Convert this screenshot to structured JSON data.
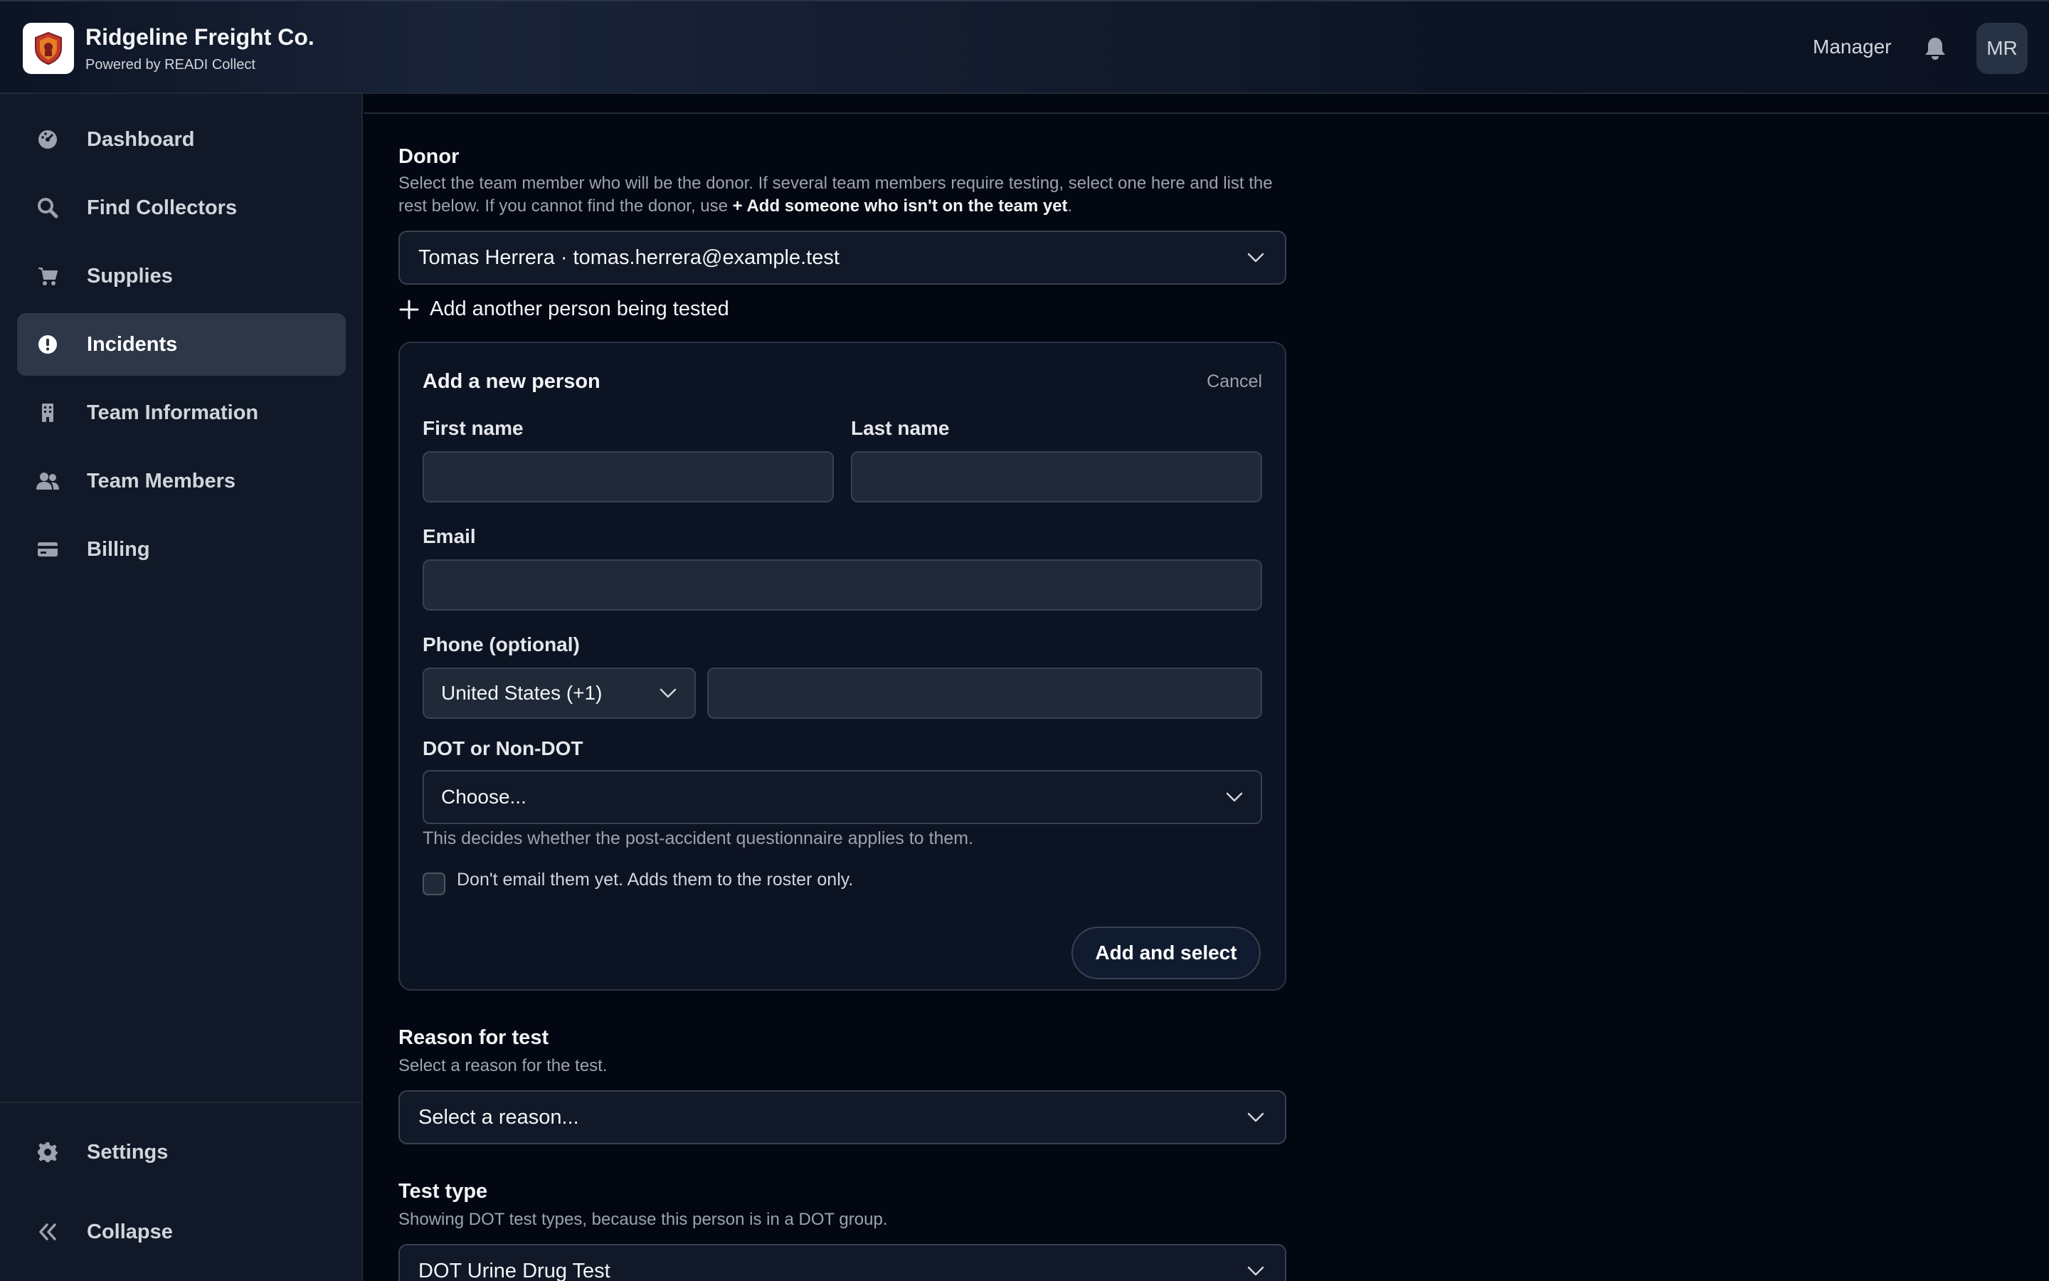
{
  "header": {
    "title": "Ridgeline Freight Co.",
    "subtitle": "Powered by READI Collect",
    "role": "Manager",
    "avatar_initials": "MR",
    "logo_icon": "shield-logo",
    "bell_icon": "bell-icon"
  },
  "sidebar": {
    "items": [
      {
        "label": "Dashboard",
        "icon": "gauge-icon",
        "active": false
      },
      {
        "label": "Find Collectors",
        "icon": "search-icon",
        "active": false
      },
      {
        "label": "Supplies",
        "icon": "cart-icon",
        "active": false
      },
      {
        "label": "Incidents",
        "icon": "alert-icon",
        "active": true
      },
      {
        "label": "Team Information",
        "icon": "building-icon",
        "active": false
      },
      {
        "label": "Team Members",
        "icon": "users-icon",
        "active": false
      },
      {
        "label": "Billing",
        "icon": "card-icon",
        "active": false
      }
    ],
    "footer": [
      {
        "label": "Settings",
        "icon": "gear-icon"
      },
      {
        "label": "Collapse",
        "icon": "double-chevron-left-icon"
      }
    ]
  },
  "donor": {
    "title": "Donor",
    "help_part1": "Select the team member who will be the donor. If several team members require testing, select one here and list the rest below. If you cannot find the donor, use",
    "help_link": "+ Add someone who isn't on the team yet",
    "help_end": ".",
    "selected": "Tomas Herrera · tomas.herrera@example.test",
    "add_another": "Add another person being tested"
  },
  "new_person": {
    "title": "Add a new person",
    "cancel": "Cancel",
    "first_name_label": "First name",
    "first_name_value": "",
    "last_name_label": "Last name",
    "last_name_value": "",
    "email_label": "Email",
    "email_value": "",
    "phone_label": "Phone (optional)",
    "phone_country": "United States (+1)",
    "phone_value": "",
    "dot_label": "DOT or Non-DOT",
    "dot_value": "Choose...",
    "dot_hint": "This decides whether the post-accident questionnaire applies to them.",
    "no_email_label": "Don't email them yet. Adds them to the roster only.",
    "no_email_checked": false,
    "submit": "Add and select"
  },
  "reason": {
    "title": "Reason for test",
    "help": "Select a reason for the test.",
    "value": "Select a reason..."
  },
  "test_type": {
    "title": "Test type",
    "help": "Showing DOT test types, because this person is in a DOT group.",
    "value": "DOT Urine Drug Test"
  }
}
